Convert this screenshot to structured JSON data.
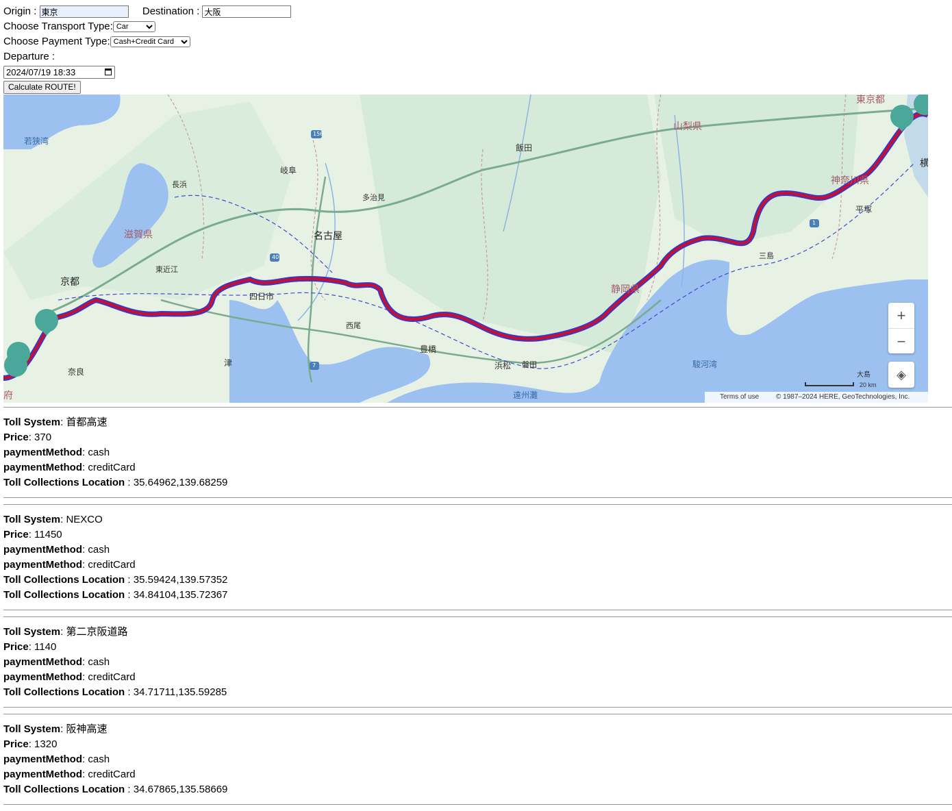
{
  "form": {
    "origin_label": "Origin :",
    "origin_value": "東京",
    "destination_label": "Destination :",
    "destination_value": "大阪",
    "transport_label": "Choose Transport Type:",
    "transport_value": "Car",
    "payment_label": "Choose Payment Type:",
    "payment_value": "Cash+Credit Card",
    "departure_label": "Departure :",
    "departure_value": "2024/07/19 18:33",
    "calculate_label": "Calculate ROUTE!"
  },
  "map": {
    "labels": [
      "東京都",
      "山梨県",
      "飯田",
      "若狭湾",
      "岐阜",
      "長浜",
      "多治見",
      "滋賀県",
      "名古屋",
      "東近江",
      "京都",
      "四日市",
      "西尾",
      "豊橋",
      "浜松",
      "磐田",
      "津",
      "奈良",
      "府",
      "静岡県",
      "三島",
      "平塚",
      "神奈川県",
      "横",
      "駿河湾",
      "遠州灘",
      "大島"
    ],
    "route_shield_labels": [
      "156",
      "40",
      "7",
      "1"
    ],
    "zoom_in": "+",
    "zoom_out": "−",
    "scale": "20 km",
    "terms": "Terms of use",
    "copyright": "© 1987–2024 HERE, GeoTechnologies, Inc.",
    "colors": {
      "route": "#c8102e",
      "route_outline": "#3a36c8",
      "water": "#9cc1f0",
      "land": "#e8f2e4",
      "marker": "#4aa89a"
    }
  },
  "results_labels": {
    "toll_system": "Toll System",
    "price": "Price",
    "payment_method": "paymentMethod",
    "location": "Toll Collections Location"
  },
  "results": [
    {
      "system": "首都高速",
      "price": "370",
      "methods": [
        "cash",
        "creditCard"
      ],
      "locations": [
        "35.64962,139.68259"
      ]
    },
    {
      "system": "NEXCO",
      "price": "11450",
      "methods": [
        "cash",
        "creditCard"
      ],
      "locations": [
        "35.59424,139.57352",
        "34.84104,135.72367"
      ]
    },
    {
      "system": "第二京阪道路",
      "price": "1140",
      "methods": [
        "cash",
        "creditCard"
      ],
      "locations": [
        "34.71711,135.59285"
      ]
    },
    {
      "system": "阪神高速",
      "price": "1320",
      "methods": [
        "cash",
        "creditCard"
      ],
      "locations": [
        "34.67865,135.58669"
      ]
    }
  ]
}
